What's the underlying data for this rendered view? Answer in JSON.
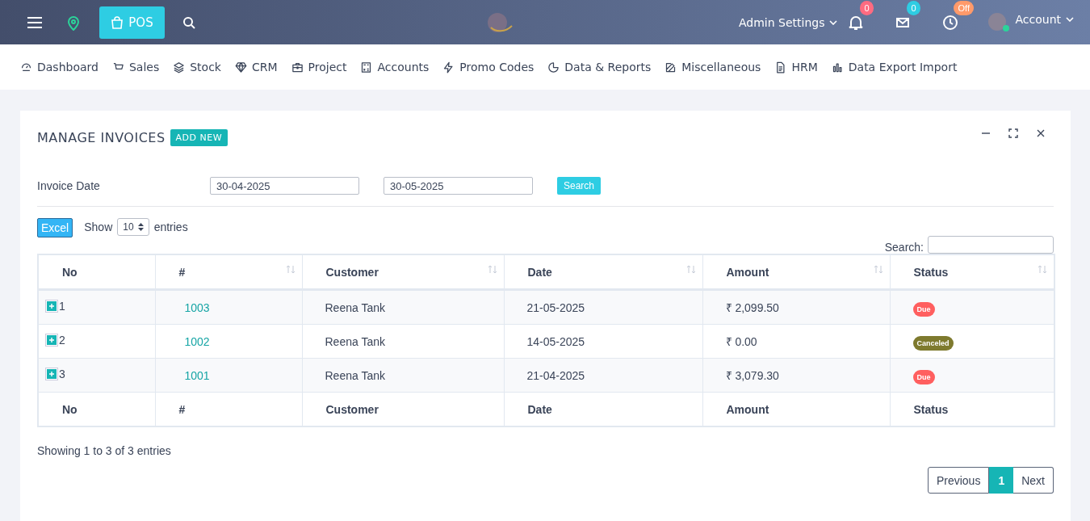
{
  "topbar": {
    "pos_button": "POS",
    "admin_settings": "Admin Settings",
    "notification_count": "0",
    "message_count": "0",
    "clock_status": "Off",
    "account": "Account"
  },
  "nav": [
    {
      "label": "Dashboard"
    },
    {
      "label": "Sales"
    },
    {
      "label": "Stock"
    },
    {
      "label": "CRM"
    },
    {
      "label": "Project"
    },
    {
      "label": "Accounts"
    },
    {
      "label": "Promo Codes"
    },
    {
      "label": "Data & Reports"
    },
    {
      "label": "Miscellaneous"
    },
    {
      "label": "HRM"
    },
    {
      "label": "Data Export Import"
    }
  ],
  "panel": {
    "title": "MANAGE INVOICES",
    "add_new": "ADD NEW",
    "filter": {
      "label": "Invoice Date",
      "from": "30-04-2025",
      "to": "30-05-2025",
      "search_button": "Search"
    },
    "excel_button": "Excel",
    "show_label": "Show",
    "page_size": "10",
    "entries_label": "entries",
    "search_label": "Search:",
    "table": {
      "columns": [
        {
          "label": "No",
          "sortable": false
        },
        {
          "label": "#",
          "sortable": true
        },
        {
          "label": "Customer",
          "sortable": true
        },
        {
          "label": "Date",
          "sortable": true
        },
        {
          "label": "Amount",
          "sortable": true
        },
        {
          "label": "Status",
          "sortable": true
        }
      ],
      "rows": [
        {
          "no": "1",
          "number": "1003",
          "customer": "Reena Tank",
          "date": "21-05-2025",
          "amount": "₹ 2,099.50",
          "status": {
            "label": "Due",
            "color": "#ff5f5f"
          }
        },
        {
          "no": "2",
          "number": "1002",
          "customer": "Reena Tank",
          "date": "14-05-2025",
          "amount": "₹ 0.00",
          "status": {
            "label": "Canceled",
            "color": "#7e7a2e"
          }
        },
        {
          "no": "3",
          "number": "1001",
          "customer": "Reena Tank",
          "date": "21-04-2025",
          "amount": "₹ 3,079.30",
          "status": {
            "label": "Due",
            "color": "#ff5f5f"
          }
        }
      ],
      "footer": [
        "No",
        "#",
        "Customer",
        "Date",
        "Amount",
        "Status"
      ]
    },
    "info": "Showing 1 to 3 of 3 entries",
    "pagination": {
      "previous": "Previous",
      "pages": [
        {
          "label": "1",
          "selected": true
        }
      ],
      "next": "Next"
    }
  }
}
